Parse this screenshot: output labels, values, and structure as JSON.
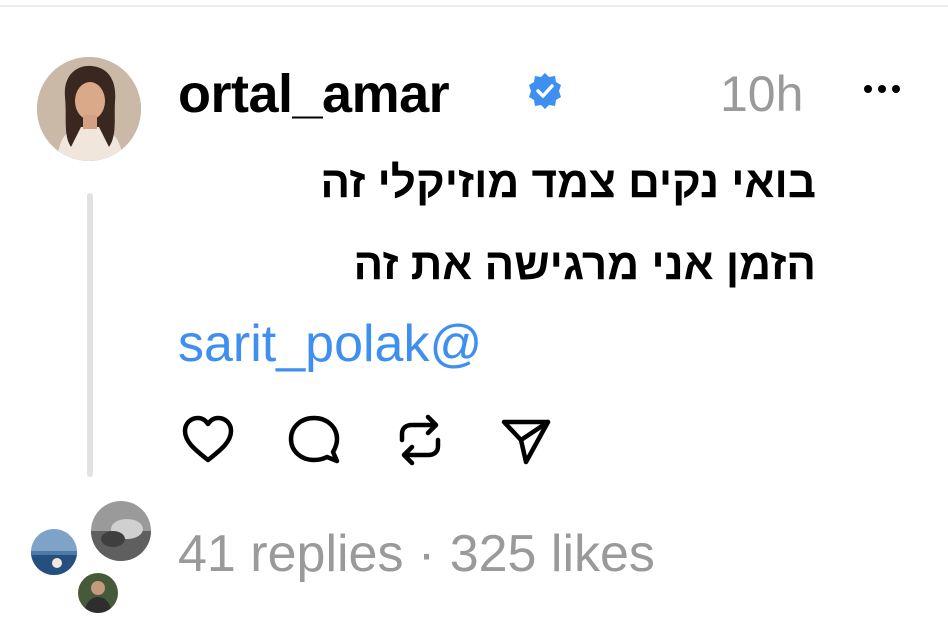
{
  "post": {
    "username": "ortal_amar",
    "verified": true,
    "timestamp": "10h",
    "caption_lines": [
      "בואי נקים צמד מוזיקלי זה",
      "הזמן אני מרגישה את זה"
    ],
    "mention": "sarit_polak@"
  },
  "actions": [
    "heart-icon",
    "comment-icon",
    "repost-icon",
    "share-icon"
  ],
  "stats": {
    "replies": "41 replies",
    "separator": "·",
    "likes": "325 likes"
  },
  "colors": {
    "verified_badge": "#3e8ff0",
    "mention": "#3e8ff0",
    "muted_text": "#9a9a9a"
  }
}
